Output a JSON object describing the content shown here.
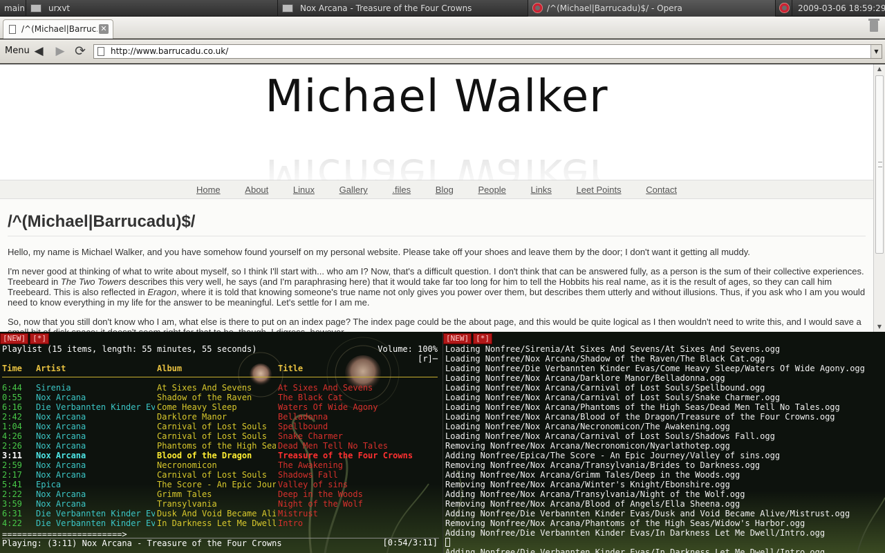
{
  "taskbar": {
    "workspace": "main",
    "windows": [
      {
        "label": "urxvt"
      },
      {
        "label": "Nox Arcana - Treasure of the Four Crowns"
      },
      {
        "label": "/^(Michael|Barrucadu)$/ - Opera"
      }
    ],
    "clock": "2009-03-06 18:59:29"
  },
  "browser": {
    "tab_label": "/^(Michael|Barruc...",
    "tab_close": "✕",
    "menu_label": "Menu",
    "back_glyph": "◀",
    "forward_glyph": "▶",
    "reload_glyph": "⟳",
    "url": "http://www.barrucadu.co.uk/",
    "url_dropdown": "▼"
  },
  "page": {
    "site_title": "Michael Walker",
    "nav": [
      "Home",
      "About",
      "Linux",
      "Gallery",
      ".files",
      "Blog",
      "People",
      "Links",
      "Leet Points",
      "Contact"
    ],
    "heading": "/^(Michael|Barrucadu)$/",
    "para1": "Hello, my name is Michael Walker, and you have somehow found yourself on my personal website. Please take off your shoes and leave them by the door; I don't want it getting all muddy.",
    "para2_a": "I'm never good at thinking of what to write about myself, so I think I'll start with... who am I? Now, that's a difficult question. I don't think that can be answered fully, as a person is the sum of their collective experiences. Treebeard in ",
    "para2_book1": "The Two Towers",
    "para2_b": " describes this very well, he says (and I'm paraphrasing here) that it would take far too long for him to tell the Hobbits his real name, as it is the result of ages, so they can call him Treebeard. This is also reflected in ",
    "para2_book2": "Eragon",
    "para2_c": ", where it is told that knowing someone's true name not only gives you power over them, but describes them utterly and without illusions. Thus, if you ask who I am you would need to know everything in my life for the answer to be meaningful. Let's settle for I am me.",
    "para3": "So, now that you still don't know who I am, what else is there to put on an index page? The index page could be the about page, and this would be quite logical as I then wouldn't need to write this, and I would save a small bit of disk space; it doesn't seem right for that to be, though. I digress, however."
  },
  "player": {
    "tabs": [
      "[NEW]",
      "[*]"
    ],
    "header": "Playlist (15 items, length: 55 minutes, 55 seconds)",
    "volume": "Volume: 100%",
    "repeat": "[r]─",
    "columns": {
      "time": "Time",
      "artist": "Artist",
      "album": "Album",
      "title": "Title"
    },
    "rows": [
      {
        "time": "6:44",
        "artist": "Sirenia",
        "album": "At Sixes And Sevens",
        "title": "At Sixes And Sevens"
      },
      {
        "time": "0:55",
        "artist": "Nox Arcana",
        "album": "Shadow of the Raven",
        "title": "The Black Cat"
      },
      {
        "time": "6:16",
        "artist": "Die Verbannten Kinder Ev",
        "album": "Come Heavy Sleep",
        "title": "Waters Of Wide Agony"
      },
      {
        "time": "2:42",
        "artist": "Nox Arcana",
        "album": "Darklore Manor",
        "title": "Belladonna"
      },
      {
        "time": "1:04",
        "artist": "Nox Arcana",
        "album": "Carnival of Lost Souls",
        "title": "Spellbound"
      },
      {
        "time": "4:26",
        "artist": "Nox Arcana",
        "album": "Carnival of Lost Souls",
        "title": "Snake Charmer"
      },
      {
        "time": "2:26",
        "artist": "Nox Arcana",
        "album": "Phantoms of the High Sea",
        "title": "Dead Men Tell No Tales"
      },
      {
        "time": "3:11",
        "artist": "Nox Arcana",
        "album": "Blood of the Dragon",
        "title": "Treasure of the Four Crowns",
        "current": true
      },
      {
        "time": "2:59",
        "artist": "Nox Arcana",
        "album": "Necronomicon",
        "title": "The Awakening"
      },
      {
        "time": "2:17",
        "artist": "Nox Arcana",
        "album": "Carnival of Lost Souls",
        "title": "Shadows Fall"
      },
      {
        "time": "5:41",
        "artist": "Epica",
        "album": "The Score - An Epic Jour",
        "title": "Valley of sins"
      },
      {
        "time": "2:22",
        "artist": "Nox Arcana",
        "album": "Grimm Tales",
        "title": "Deep in the Woods"
      },
      {
        "time": "3:59",
        "artist": "Nox Arcana",
        "album": "Transylvania",
        "title": "Night of the Wolf"
      },
      {
        "time": "6:31",
        "artist": "Die Verbannten Kinder Ev",
        "album": "Dusk And Void Became Ali",
        "title": "Mistrust"
      },
      {
        "time": "4:22",
        "artist": "Die Verbannten Kinder Ev",
        "album": "In Darkness Let Me Dwell",
        "title": "Intro"
      }
    ],
    "progress": "========================>",
    "playing": "Playing: (3:11) Nox Arcana - Treasure of the Four Crowns",
    "position": "[0:54/3:11]"
  },
  "log": {
    "tabs": [
      "[NEW]",
      "[*]"
    ],
    "lines": [
      "Loading Nonfree/Sirenia/At Sixes And Sevens/At Sixes And Sevens.ogg",
      "Loading Nonfree/Nox Arcana/Shadow of the Raven/The Black Cat.ogg",
      "Loading Nonfree/Die Verbannten Kinder Evas/Come Heavy Sleep/Waters Of Wide Agony.ogg",
      "Loading Nonfree/Nox Arcana/Darklore Manor/Belladonna.ogg",
      "Loading Nonfree/Nox Arcana/Carnival of Lost Souls/Spellbound.ogg",
      "Loading Nonfree/Nox Arcana/Carnival of Lost Souls/Snake Charmer.ogg",
      "Loading Nonfree/Nox Arcana/Phantoms of the High Seas/Dead Men Tell No Tales.ogg",
      "Loading Nonfree/Nox Arcana/Blood of the Dragon/Treasure of the Four Crowns.ogg",
      "Loading Nonfree/Nox Arcana/Necronomicon/The Awakening.ogg",
      "Loading Nonfree/Nox Arcana/Carnival of Lost Souls/Shadows Fall.ogg",
      "Removing Nonfree/Nox Arcana/Necronomicon/Nyarlathotep.ogg",
      "Adding Nonfree/Epica/The Score - An Epic Journey/Valley of sins.ogg",
      "Removing Nonfree/Nox Arcana/Transylvania/Brides to Darkness.ogg",
      "Adding Nonfree/Nox Arcana/Grimm Tales/Deep in the Woods.ogg",
      "Removing Nonfree/Nox Arcana/Winter's Knight/Ebonshire.ogg",
      "Adding Nonfree/Nox Arcana/Transylvania/Night of the Wolf.ogg",
      "Removing Nonfree/Nox Arcana/Blood of Angels/Ella Sheena.ogg",
      "Adding Nonfree/Die Verbannten Kinder Evas/Dusk and Void Became Alive/Mistrust.ogg",
      "Removing Nonfree/Nox Arcana/Phantoms of the High Seas/Widow's Harbor.ogg",
      "Adding Nonfree/Die Verbannten Kinder Evas/In Darkness Let Me Dwell/Intro.ogg"
    ],
    "overflow_line": "Adding Nonfree/Die Verbannten Kinder Evas/In Darkness Let Me Dwell/Intro.ogg"
  }
}
